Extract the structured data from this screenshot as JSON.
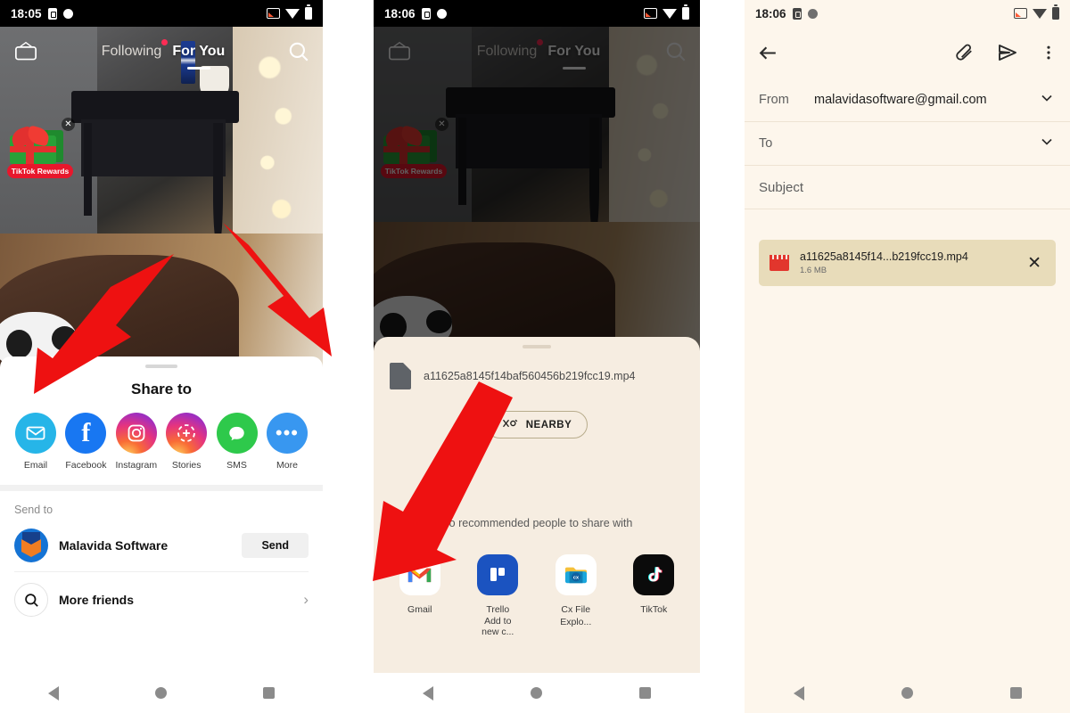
{
  "panels": {
    "tiktok_share": {
      "status": {
        "time": "18:05"
      },
      "app": {
        "live_label": "LIVE",
        "tab_following": "Following",
        "tab_foryou": "For You",
        "search_icon": "search-icon",
        "rewards_label": "TikTok Rewards",
        "rewards_close": "✕"
      },
      "sheet": {
        "title": "Share to",
        "apps": [
          {
            "label": "Email",
            "icon": "email-icon"
          },
          {
            "label": "Facebook",
            "icon": "facebook-icon"
          },
          {
            "label": "Instagram",
            "icon": "instagram-icon"
          },
          {
            "label": "Stories",
            "icon": "stories-icon"
          },
          {
            "label": "SMS",
            "icon": "sms-icon"
          },
          {
            "label": "More",
            "icon": "more-icon"
          }
        ],
        "send_to_label": "Send to",
        "contact_name": "Malavida Software",
        "send_button": "Send",
        "more_friends": "More friends",
        "chevron": "›"
      }
    },
    "android_share": {
      "status": {
        "time": "18:06"
      },
      "app": {
        "live_label": "LIVE",
        "tab_following": "Following",
        "tab_foryou": "For You",
        "rewards_label": "TikTok Rewards",
        "rewards_close": "✕"
      },
      "sheet": {
        "file_name": "a11625a8145f14baf560456b219fcc19.mp4",
        "nearby_label": "NEARBY",
        "no_recommended": "No recommended people to share with",
        "apps": [
          {
            "label": "Gmail",
            "sub": "",
            "icon": "gmail-icon"
          },
          {
            "label": "Trello",
            "sub": "Add to new c...",
            "icon": "trello-icon"
          },
          {
            "label": "Cx File Explo...",
            "sub": "",
            "icon": "cx-file-explorer-icon"
          },
          {
            "label": "TikTok",
            "sub": "",
            "icon": "tiktok-icon"
          }
        ]
      }
    },
    "gmail_compose": {
      "status": {
        "time": "18:06"
      },
      "toolbar": {
        "back_icon": "back-arrow-icon",
        "attach_icon": "paperclip-icon",
        "send_icon": "send-icon",
        "overflow_icon": "more-vertical-icon"
      },
      "fields": {
        "from_label": "From",
        "from_value": "malavidasoftware@gmail.com",
        "to_label": "To",
        "to_value": "",
        "subject_placeholder": "Subject"
      },
      "attachment": {
        "name": "a11625a8145f14...b219fcc19.mp4",
        "size": "1.6 MB",
        "remove": "✕"
      }
    }
  },
  "navbar": {
    "back": "back-triangle-icon",
    "home": "home-circle-icon",
    "recents": "recents-square-icon"
  },
  "colors": {
    "tiktok_red": "#fe2c55",
    "arrow_red": "#ee1111",
    "gmail_bg": "#fdf6ec",
    "share_bg": "#f6ede1",
    "chip_bg": "#e8dcba"
  }
}
